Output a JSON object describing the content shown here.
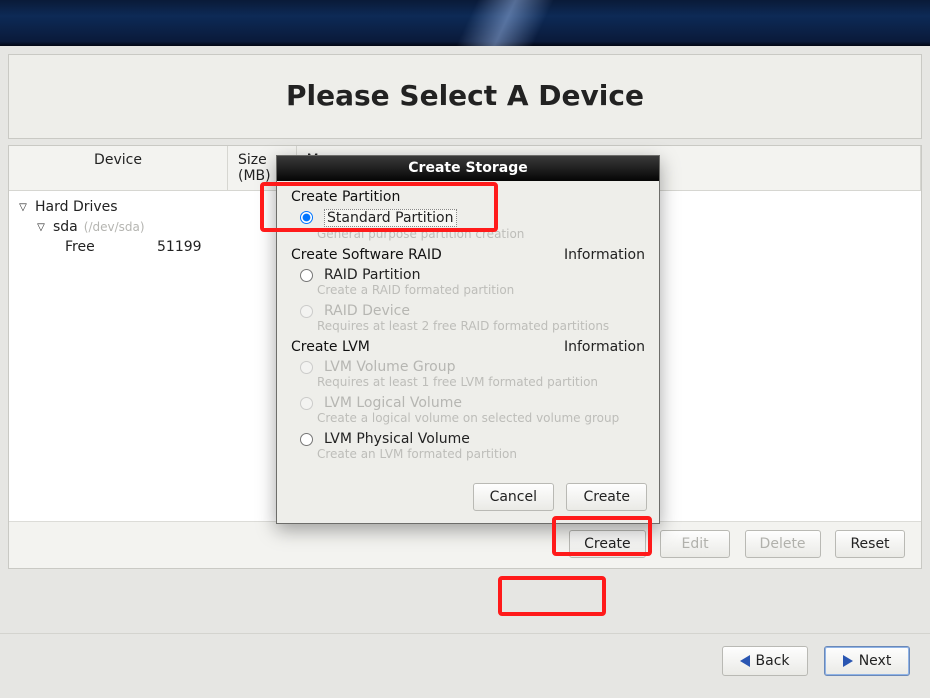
{
  "page_title": "Please Select A Device",
  "columns": {
    "device": "Device",
    "size": "Size\n(MB)",
    "mount": "Mo\nRA"
  },
  "tree": {
    "root_label": "Hard Drives",
    "disk_label": "sda",
    "disk_path": "(/dev/sda)",
    "free_label": "Free",
    "free_size": "51199"
  },
  "toolbar": {
    "create": "Create",
    "edit": "Edit",
    "delete": "Delete",
    "reset": "Reset"
  },
  "nav": {
    "back": "Back",
    "next": "Next"
  },
  "dialog": {
    "title": "Create Storage",
    "section_partition": "Create Partition",
    "standard_partition": "Standard Partition",
    "standard_partition_desc": "General purpose partition creation",
    "section_raid": "Create Software RAID",
    "raid_partition": "RAID Partition",
    "raid_partition_desc": "Create a RAID formated partition",
    "raid_device": "RAID Device",
    "raid_device_desc": "Requires at least 2 free RAID formated partitions",
    "section_lvm": "Create LVM",
    "lvm_vg": "LVM Volume Group",
    "lvm_vg_desc": "Requires at least 1 free LVM formated partition",
    "lvm_lv": "LVM Logical Volume",
    "lvm_lv_desc": "Create a logical volume on selected volume group",
    "lvm_pv": "LVM Physical Volume",
    "lvm_pv_desc": "Create an LVM formated partition",
    "information": "Information",
    "cancel": "Cancel",
    "create": "Create"
  }
}
